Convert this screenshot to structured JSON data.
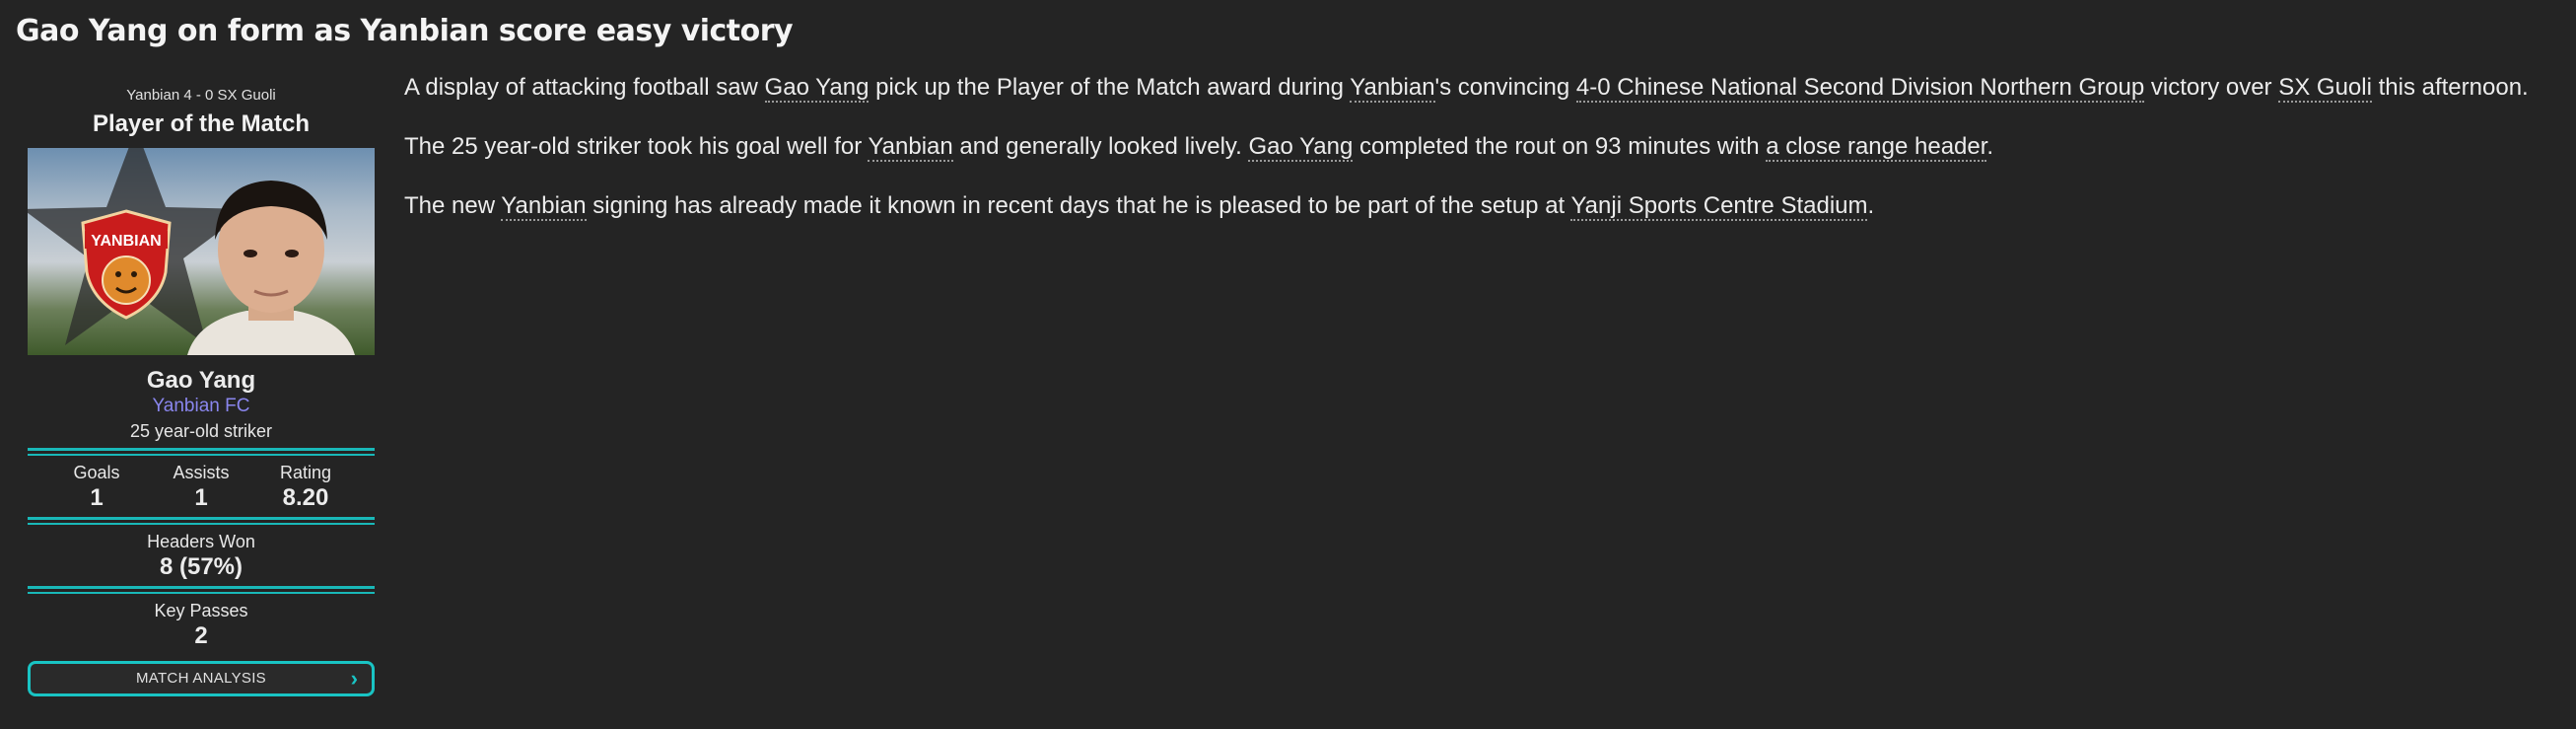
{
  "headline": "Gao Yang on form as Yanbian score easy victory",
  "potm": {
    "score_line": "Yanbian 4 - 0 SX Guoli",
    "title": "Player of the Match",
    "player_name": "Gao Yang",
    "club": "Yanbian FC",
    "description": "25 year-old striker",
    "crest_text": "YANBIAN",
    "stats": [
      {
        "label": "Goals",
        "value": "1"
      },
      {
        "label": "Assists",
        "value": "1"
      },
      {
        "label": "Rating",
        "value": "8.20"
      }
    ],
    "headers_won": {
      "label": "Headers Won",
      "value": "8 (57%)"
    },
    "key_passes": {
      "label": "Key Passes",
      "value": "2"
    },
    "button_label": "MATCH ANALYSIS"
  },
  "article": {
    "p1": {
      "t1": "A display of attacking football saw ",
      "player": "Gao Yang",
      "t2": " pick up the Player of the Match award during ",
      "club": "Yanbian",
      "t3": "'s convincing ",
      "match": "4-0 Chinese National Second Division Northern Group",
      "t4": " victory over ",
      "opponent": "SX Guoli",
      "t5": " this afternoon."
    },
    "p2": {
      "t1": "The 25 year-old striker took his goal well for ",
      "club": "Yanbian",
      "t2": " and generally looked lively. ",
      "player": "Gao Yang",
      "t3": " completed the rout on 93 minutes with ",
      "goal": "a close range header",
      "t4": "."
    },
    "p3": {
      "t1": "The new ",
      "club": "Yanbian",
      "t2": " signing has already made it known in recent days that he is pleased to be part of the setup at ",
      "stadium": "Yanji Sports Centre Stadium",
      "t3": "."
    }
  }
}
